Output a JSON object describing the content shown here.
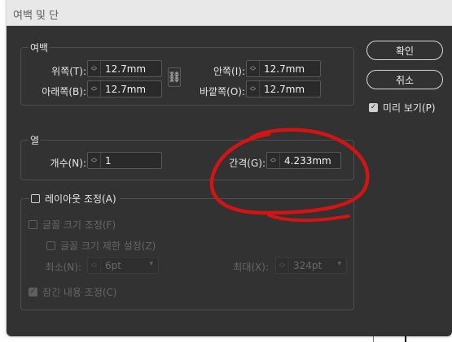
{
  "window": {
    "title": "여백 및 단"
  },
  "margins": {
    "title": "여백",
    "top": {
      "label": "위쪽(T):",
      "value": "12.7mm"
    },
    "bottom": {
      "label": "아래쪽(B):",
      "value": "12.7mm"
    },
    "inside": {
      "label": "안쪽(I):",
      "value": "12.7mm"
    },
    "outside": {
      "label": "바깥쪽(O):",
      "value": "12.7mm"
    },
    "link_icon": "chain-link-icon"
  },
  "columns": {
    "title": "열",
    "number": {
      "label": "개수(N):",
      "value": "1"
    },
    "gutter": {
      "label": "간격(G):",
      "value": "4.233mm"
    }
  },
  "layout_adjust": {
    "label": "레이아웃 조정(A)",
    "checked": false,
    "font_size_adjust": {
      "label": "글꼴 크기 조정(F)",
      "checked": false
    },
    "font_size_limit": {
      "label": "글꼴 크기 제한 설정(Z)",
      "checked": false
    },
    "min": {
      "label": "최소(N):",
      "value": "6pt"
    },
    "max": {
      "label": "최대(X):",
      "value": "324pt"
    },
    "locked_content": {
      "label": "잠긴 내용 조정(C)",
      "checked": true
    }
  },
  "buttons": {
    "ok": "확인",
    "cancel": "취소"
  },
  "preview": {
    "label": "미리 보기(P)",
    "checked": true
  },
  "colors": {
    "dialog_bg": "#323232",
    "annotation": "#d11414"
  }
}
